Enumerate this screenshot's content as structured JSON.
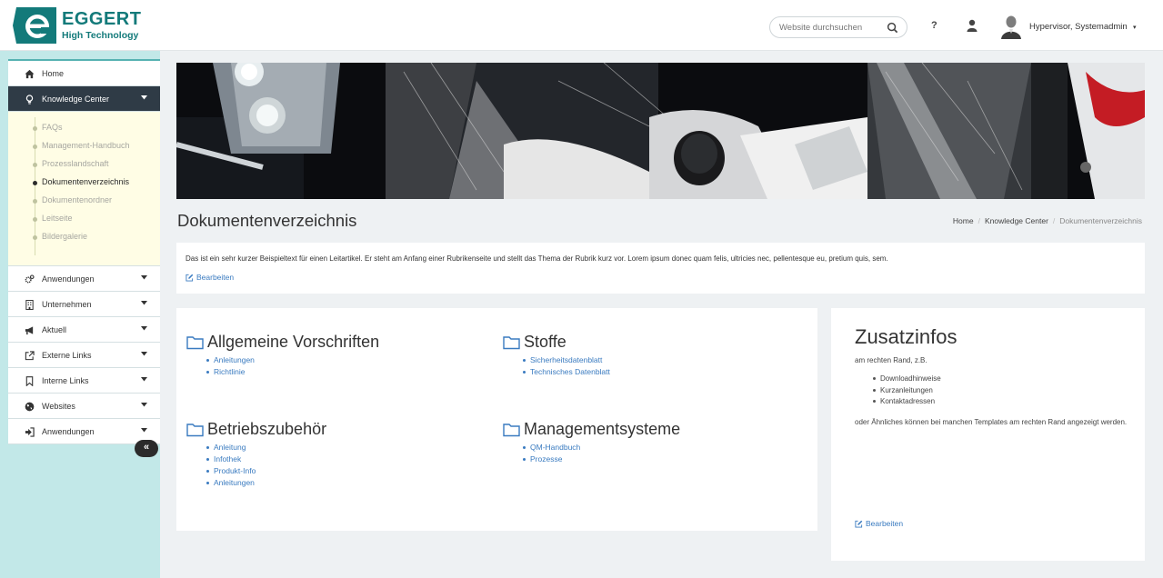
{
  "brand": {
    "name": "EGGERT",
    "tagline": "High Technology"
  },
  "header": {
    "search_placeholder": "Website durchsuchen",
    "help_label": "?",
    "user_name": "Hypervisor, Systemadmin",
    "user_caret": "▾"
  },
  "sidebar": {
    "items": [
      {
        "label": "Home",
        "icon": "home-icon"
      },
      {
        "label": "Knowledge Center",
        "icon": "lightbulb-icon"
      },
      {
        "label": "Anwendungen",
        "icon": "cogs-icon"
      },
      {
        "label": "Unternehmen",
        "icon": "building-icon"
      },
      {
        "label": "Aktuell",
        "icon": "bullhorn-icon"
      },
      {
        "label": "Externe Links",
        "icon": "external-link-icon"
      },
      {
        "label": "Interne Links",
        "icon": "bookmark-icon"
      },
      {
        "label": "Websites",
        "icon": "globe-icon"
      },
      {
        "label": "Anwendungen",
        "icon": "sign-in-icon"
      }
    ],
    "subitems": [
      "FAQs",
      "Management-Handbuch",
      "Prozesslandschaft",
      "Dokumentenverzeichnis",
      "Dokumentenordner",
      "Leitseite",
      "Bildergalerie"
    ],
    "collapse_label": "«"
  },
  "page": {
    "title": "Dokumentenverzeichnis",
    "breadcrumb": [
      "Home",
      "Knowledge Center",
      "Dokumentenverzeichnis"
    ],
    "breadcrumb_sep": "/"
  },
  "intro": {
    "text": "Das ist ein sehr kurzer Beispieltext für einen Leitartikel. Er steht am Anfang einer Rubrikenseite und stellt das Thema der Rubrik kurz vor. Lorem ipsum donec quam felis, ultricies nec, pellentesque eu, pretium quis, sem.",
    "edit_label": "Bearbeiten"
  },
  "categories": [
    {
      "title": "Allgemeine Vorschriften",
      "links": [
        "Anleitungen",
        "Richtlinie"
      ]
    },
    {
      "title": "Stoffe",
      "links": [
        "Sicherheitsdatenblatt",
        "Technisches Datenblatt"
      ]
    },
    {
      "title": "Betriebszubehör",
      "links": [
        "Anleitung",
        "Infothek",
        "Produkt-Info",
        "Anleitungen"
      ]
    },
    {
      "title": "Managementsysteme",
      "links": [
        "QM-Handbuch",
        "Prozesse"
      ]
    }
  ],
  "aside": {
    "title": "Zusatzinfos",
    "subtitle": "am rechten Rand, z.B.",
    "list": [
      "Downloadhinweise",
      "Kurzanleitungen",
      "Kontaktadressen"
    ],
    "text": "oder Ähnliches können bei manchen Templates am rechten Rand angezeigt werden.",
    "edit_label": "Bearbeiten"
  },
  "colors": {
    "brand": "#137a7a",
    "sidebar_bg": "#c2e8e8",
    "sidebar_active": "#2f3b46",
    "submenu_bg": "#fffde5",
    "link": "#3a7bc0",
    "page_bg": "#eef1f3"
  }
}
